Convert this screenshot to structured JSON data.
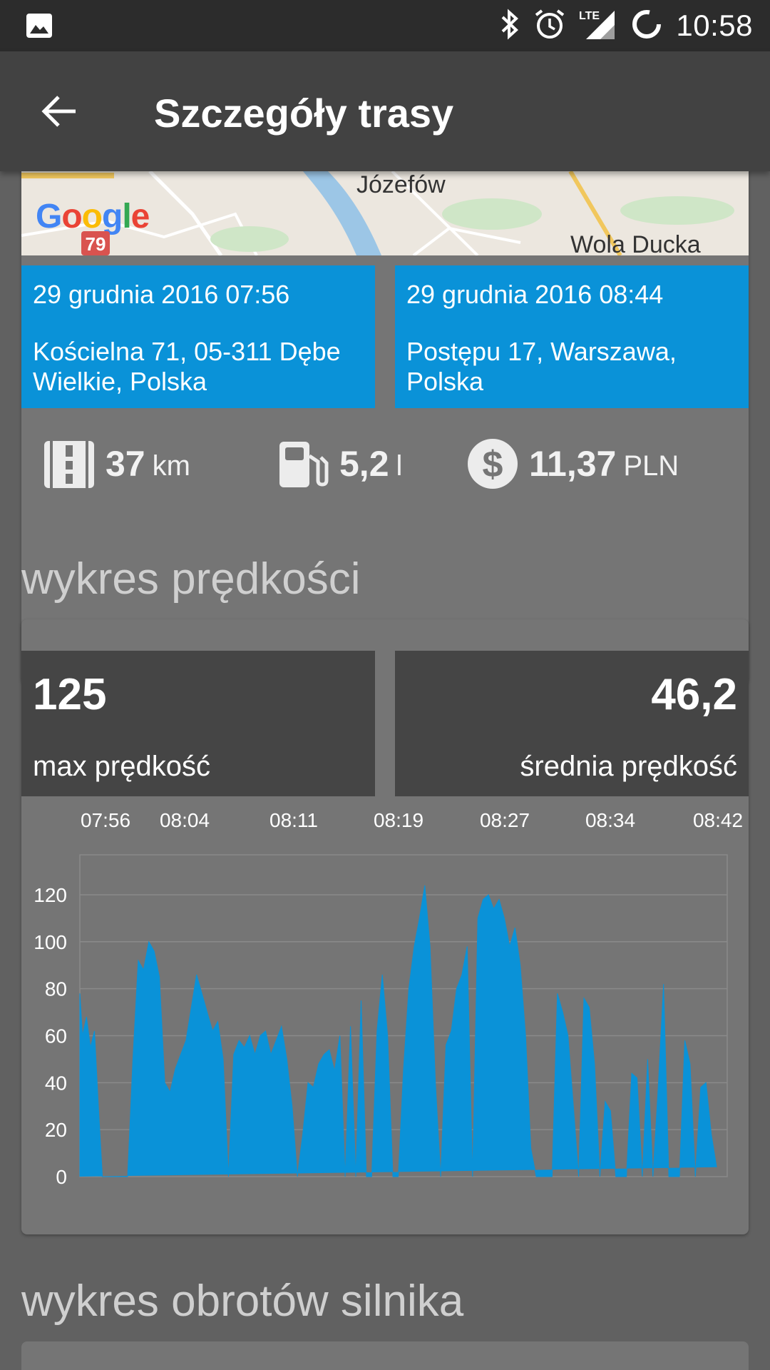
{
  "status_bar": {
    "time": "10:58",
    "icons": [
      "image-icon",
      "bluetooth-icon",
      "alarm-icon",
      "lte-signal-icon",
      "sync-icon"
    ],
    "lte_label": "LTE"
  },
  "app_bar": {
    "title": "Szczegóły trasy",
    "back_icon": "arrow-back-icon"
  },
  "map": {
    "places": [
      "Józefów",
      "Wola Ducka"
    ],
    "logo": "Google",
    "route_badge": "79"
  },
  "trip": {
    "start": {
      "datetime": "29 grudnia 2016 07:56",
      "address": "Kościelna 71, 05-311 Dębe Wielkie, Polska"
    },
    "end": {
      "datetime": "29 grudnia 2016 08:44",
      "address": "Postępu 17, Warszawa, Polska"
    },
    "stats": {
      "distance": {
        "value": "37",
        "unit": "km",
        "icon": "road-icon"
      },
      "fuel": {
        "value": "5,2",
        "unit": "l",
        "icon": "fuel-pump-icon"
      },
      "cost": {
        "value": "11,37",
        "unit": "PLN",
        "icon": "dollar-icon"
      }
    }
  },
  "speed_section": {
    "title": "wykres prędkości",
    "max": {
      "value": "125",
      "label": "max prędkość"
    },
    "avg": {
      "value": "46,2",
      "label": "średnia prędkość"
    }
  },
  "rpm_section": {
    "title": "wykres obrotów silnika"
  },
  "colors": {
    "accent": "#0a92d8",
    "card": "#757575",
    "background": "#616161",
    "appbar": "#424242"
  },
  "chart_data": {
    "type": "area",
    "x_tick_labels": [
      "07:56",
      "08:04",
      "08:11",
      "08:19",
      "08:27",
      "08:34",
      "08:42"
    ],
    "y_tick_labels": [
      "0",
      "20",
      "40",
      "60",
      "80",
      "100",
      "120"
    ],
    "ylim": [
      0,
      137
    ],
    "grid": true,
    "series": [
      {
        "color": "#0a92d8",
        "x_minutes_after_0756": [
          0,
          0.2,
          0.5,
          0.8,
          1.1,
          1.4,
          1.7,
          2.0,
          2.3,
          2.6,
          2.9,
          3.2,
          3.6,
          4.0,
          4.4,
          4.8,
          5.2,
          5.6,
          6.0,
          6.4,
          6.8,
          7.2,
          7.6,
          8.0,
          8.4,
          8.8,
          9.2,
          9.6,
          10.0,
          10.4,
          10.8,
          11.2,
          11.6,
          12.0,
          12.4,
          12.8,
          13.2,
          13.6,
          14.0,
          14.4,
          14.8,
          15.2,
          15.6,
          16.0,
          16.4,
          16.8,
          17.2,
          17.6,
          18.0,
          18.4,
          18.8,
          19.2,
          19.6,
          20.0,
          20.4,
          20.8,
          21.2,
          21.6,
          22.0,
          22.4,
          22.8,
          23.2,
          23.6,
          24.0,
          24.4,
          24.8,
          25.2,
          25.6,
          26.0,
          26.4,
          26.8,
          27.2,
          27.6,
          28.0,
          28.4,
          28.8,
          29.2,
          29.6,
          30.0,
          30.4,
          30.8,
          31.2,
          31.6,
          32.0,
          32.4,
          32.8,
          33.2,
          33.6,
          34.0,
          34.4,
          34.8,
          35.2,
          35.6,
          36.0,
          36.4,
          36.8,
          37.2,
          37.6,
          38.0,
          38.4,
          38.8,
          39.2,
          39.6,
          40.0,
          40.4,
          40.8,
          41.2,
          41.6,
          42.0,
          42.4,
          42.8,
          43.2,
          43.6,
          44.0,
          44.4,
          44.8,
          45.2,
          45.6,
          46.0,
          46.4,
          46.8,
          47.2,
          47.6,
          48.0,
          48.4,
          48.8
        ],
        "y_kmh": [
          78,
          60,
          68,
          55,
          62,
          30,
          0,
          0,
          0,
          0,
          0,
          0,
          0,
          50,
          92,
          88,
          100,
          96,
          85,
          40,
          36,
          46,
          52,
          58,
          72,
          86,
          78,
          70,
          62,
          66,
          50,
          0,
          52,
          58,
          55,
          60,
          52,
          60,
          62,
          52,
          58,
          64,
          50,
          30,
          0,
          18,
          40,
          38,
          48,
          52,
          54,
          45,
          60,
          0,
          64,
          0,
          75,
          0,
          0,
          62,
          86,
          60,
          0,
          0,
          46,
          80,
          98,
          110,
          124,
          98,
          40,
          0,
          56,
          62,
          80,
          86,
          98,
          0,
          110,
          118,
          120,
          114,
          118,
          110,
          98,
          106,
          90,
          60,
          12,
          0,
          0,
          0,
          0,
          78,
          70,
          60,
          30,
          0,
          76,
          72,
          48,
          0,
          32,
          28,
          0,
          0,
          0,
          44,
          42,
          0,
          50,
          0,
          38,
          82,
          0,
          0,
          0,
          58,
          48,
          0,
          38,
          40,
          18,
          4
        ]
      }
    ]
  }
}
